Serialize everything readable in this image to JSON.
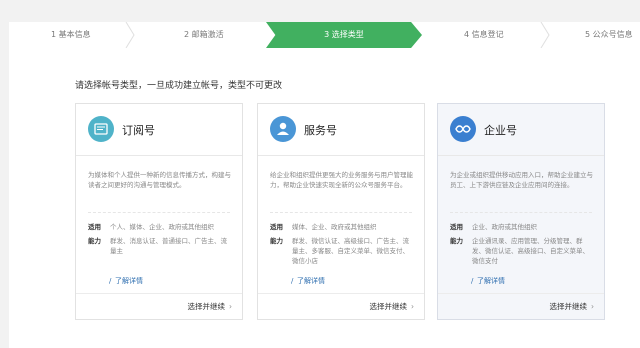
{
  "steps": [
    {
      "label": "1 基本信息"
    },
    {
      "label": "2 邮箱激活"
    },
    {
      "label": "3 选择类型"
    },
    {
      "label": "4 信息登记"
    },
    {
      "label": "5 公众号信息"
    }
  ],
  "notice": "请选择帐号类型，一旦成功建立帐号，类型不可更改",
  "colors": {
    "active": "#41b060",
    "link": "#2f6fb0",
    "subscription_icon": "#4fb3c9",
    "service_icon": "#4a96d6",
    "enterprise_icon": "#3a7fd0"
  },
  "cards": [
    {
      "icon": "subscription-icon",
      "title": "订阅号",
      "desc": "为媒体和个人提供一种新的信息传播方式，构建与读者之间更好的沟通与管理模式。",
      "suit_key": "适用",
      "suit_val": "个人、媒体、企业、政府或其他组织",
      "ability_key": "能力",
      "ability_val": "群发、消息认证、普通接口、广告主、流量主",
      "detail": "了解详情",
      "action": "选择并继续"
    },
    {
      "icon": "service-icon",
      "title": "服务号",
      "desc": "给企业和组织提供更强大的业务服务与用户管理能力，帮助企业快速实现全新的公众号服务平台。",
      "suit_key": "适用",
      "suit_val": "媒体、企业、政府或其他组织",
      "ability_key": "能力",
      "ability_val": "群发、微信认证、高级接口、广告主、流量主、多客服、自定义菜单、微信支付、微信小店",
      "detail": "了解详情",
      "action": "选择并继续"
    },
    {
      "icon": "enterprise-icon",
      "title": "企业号",
      "desc": "为企业或组织提供移动应用入口，帮助企业建立与员工、上下游供应链及企业应用间的连接。",
      "suit_key": "适用",
      "suit_val": "企业、政府或其他组织",
      "ability_key": "能力",
      "ability_val": "企业通讯录、应用管理、分级管理、群发、微信认证、高级接口、自定义菜单、微信支付",
      "detail": "了解详情",
      "action": "选择并继续"
    }
  ]
}
